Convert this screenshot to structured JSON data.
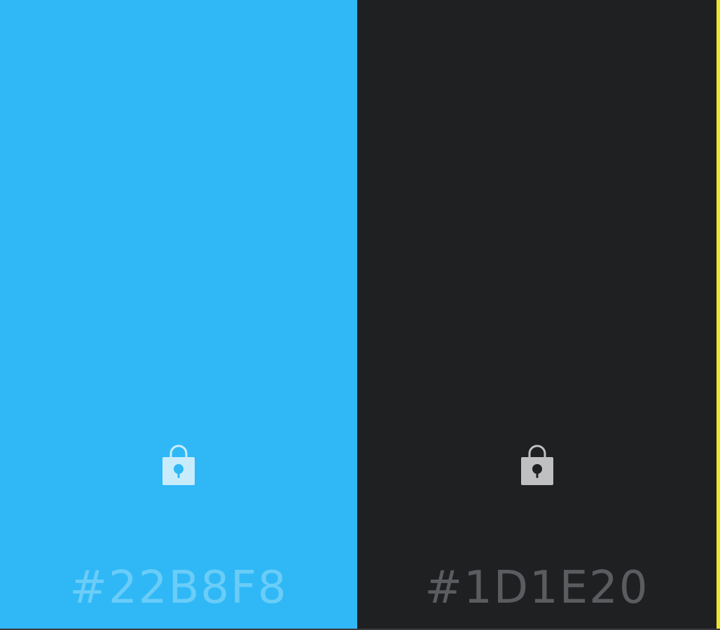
{
  "swatches": [
    {
      "hex": "#22B8F8",
      "background": "#30b8f6",
      "label_color": "#6acdf8",
      "lock_color": "#c8ecfc",
      "keyhole_color": "#30b8f6",
      "lock_icon": "lock-icon"
    },
    {
      "hex": "#1D1E20",
      "background": "#1f2022",
      "label_color": "#5b5c5f",
      "lock_color": "#c0c0c2",
      "keyhole_color": "#1f2022",
      "lock_icon": "lock-icon"
    }
  ],
  "edge_strip_color": "#f0e628"
}
